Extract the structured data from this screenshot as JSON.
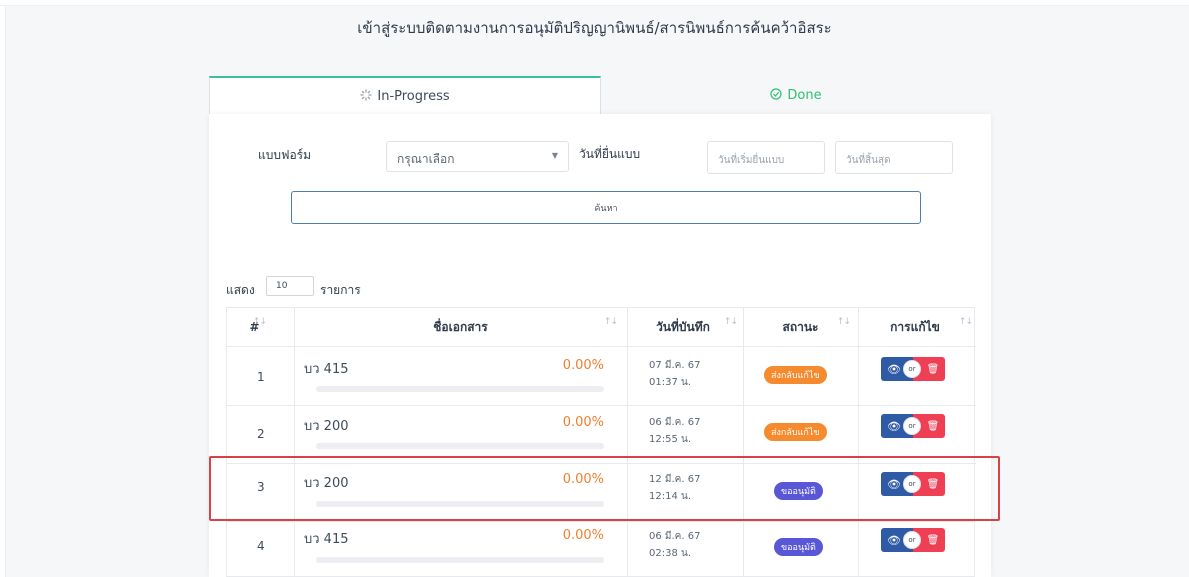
{
  "page": {
    "title": "เข้าสู่ระบบติดตามงานการอนุมัติปริญญานิพนธ์/สารนิพนธ์การค้นคว้าอิสระ"
  },
  "tabs": [
    {
      "label": "In-Progress",
      "icon": "spinner-icon",
      "active": true
    },
    {
      "label": "Done",
      "icon": "check-circle-icon",
      "active": false,
      "color": "#2fbf71"
    }
  ],
  "filters": {
    "form_label": "แบบฟอร์ม",
    "form_select_value": "กรุณาเลือก",
    "date_label": "วันที่ยื่นแบบ",
    "start_date_placeholder": "วันที่เริ่มยื่นแบบ",
    "end_date_placeholder": "วันที่สิ้นสุด",
    "search_button": "ค้นหา"
  },
  "pagination": {
    "show_label": "แสดง",
    "page_size": "10",
    "items_label": "รายการ"
  },
  "table": {
    "columns": [
      "#",
      "ชื่อเอกสาร",
      "วันที่บันทึก",
      "สถานะ",
      "การแก้ไข"
    ],
    "rows": [
      {
        "no": "1",
        "doc": "บว 415",
        "progress": "0.00%",
        "date": "07 มี.ค. 67",
        "time": "01:37 น.",
        "status": "ส่งกลับแก้ไข",
        "status_type": "returned"
      },
      {
        "no": "2",
        "doc": "บว 200",
        "progress": "0.00%",
        "date": "06 มี.ค. 67",
        "time": "12:55 น.",
        "status": "ส่งกลับแก้ไข",
        "status_type": "returned"
      },
      {
        "no": "3",
        "doc": "บว 200",
        "progress": "0.00%",
        "date": "12 มี.ค. 67",
        "time": "12:14 น.",
        "status": "ขออนุมัติ",
        "status_type": "request"
      },
      {
        "no": "4",
        "doc": "บว 415",
        "progress": "0.00%",
        "date": "06 มี.ค. 67",
        "time": "02:38 น.",
        "status": "ขออนุมัติ",
        "status_type": "request"
      }
    ],
    "action_or": "or",
    "view_icon": "eye-icon",
    "delete_icon": "trash-icon"
  },
  "colors": {
    "accent_green": "#3bbf9f",
    "progress_orange": "#f07f2f",
    "badge_returned": "#f68a2e",
    "badge_request": "#5a57d6",
    "view_button": "#2e5aa6",
    "delete_button": "#ef3f54",
    "highlight_border": "#d9414a"
  }
}
